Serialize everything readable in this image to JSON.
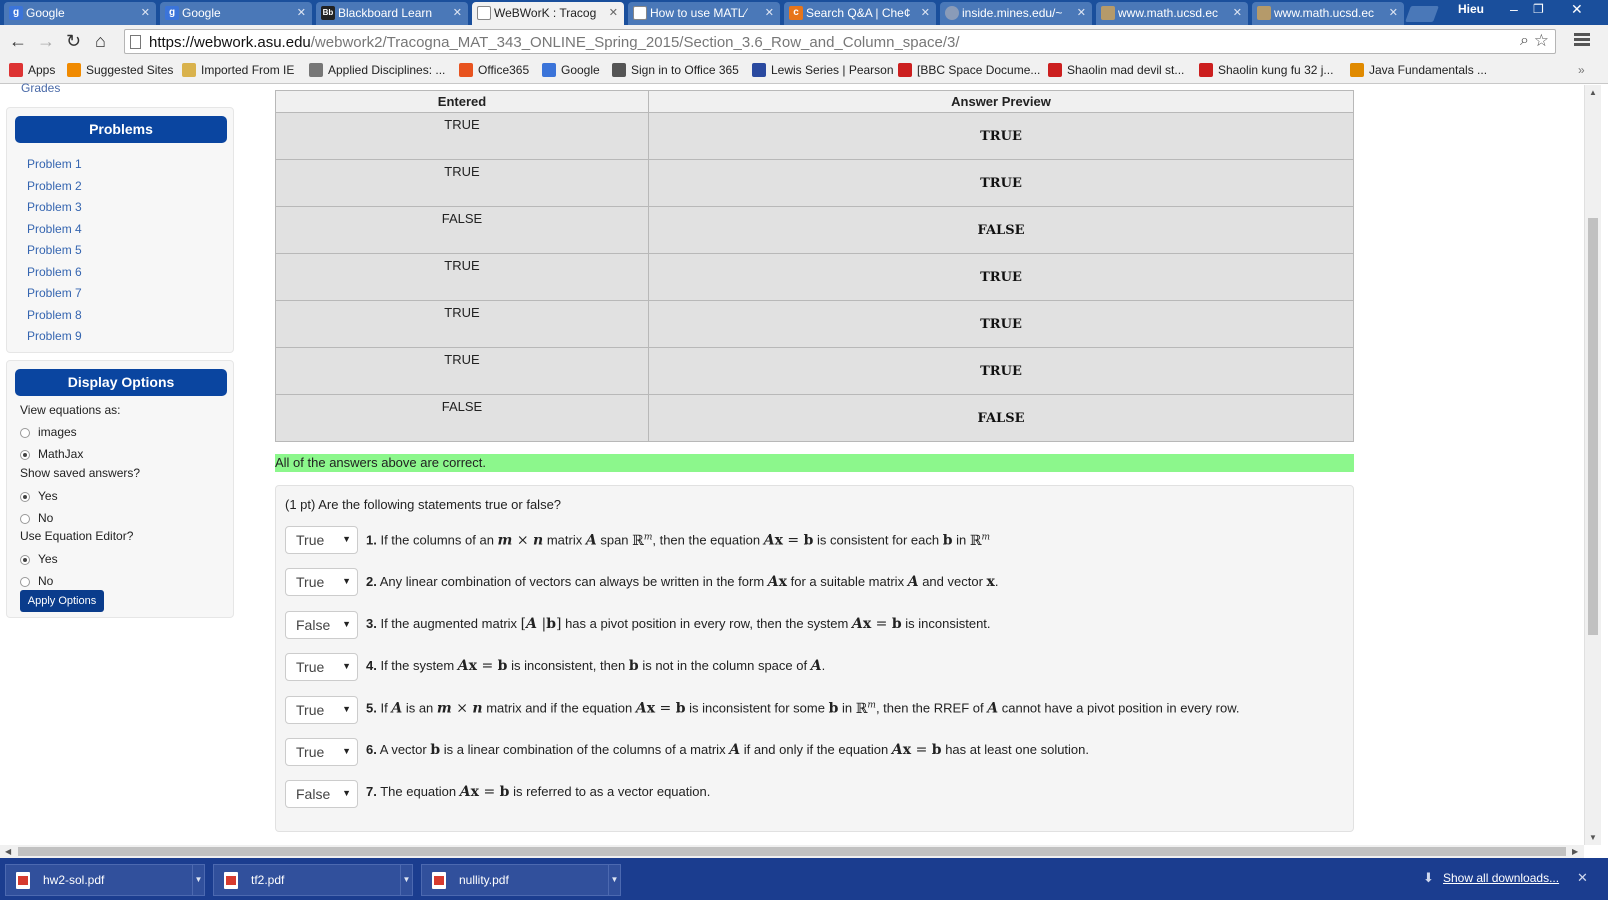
{
  "browser": {
    "tabs": [
      {
        "title": "Google",
        "favicon": "google-g-icon",
        "active": false
      },
      {
        "title": "Google",
        "favicon": "google-g-icon",
        "active": false
      },
      {
        "title": "Blackboard Learn",
        "favicon": "blackboard-icon",
        "active": false
      },
      {
        "title": "WeBWorK : Tracog",
        "favicon": "page-icon",
        "active": true
      },
      {
        "title": "How to use MATL⁄",
        "favicon": "page-icon",
        "active": false
      },
      {
        "title": "Search Q&A | Che¢",
        "favicon": "chegg-icon",
        "active": false
      },
      {
        "title": "inside.mines.edu/~",
        "favicon": "mines-icon",
        "active": false
      },
      {
        "title": "www.math.ucsd.ec",
        "favicon": "ucsd-icon",
        "active": false
      },
      {
        "title": "www.math.ucsd.ec",
        "favicon": "ucsd-icon",
        "active": false
      }
    ],
    "profile": "Hieu",
    "url_host": "https://webwork.asu.edu",
    "url_path": "/webwork2/Tracogna_MAT_343_ONLINE_Spring_2015/Section_3.6_Row_and_Column_space/3/",
    "bookmarks": [
      {
        "label": "Apps",
        "icon": "apps-grid-icon",
        "color": "#d33"
      },
      {
        "label": "Suggested Sites",
        "icon": "suggested-sites-icon",
        "color": "#f08a00"
      },
      {
        "label": "Imported From IE",
        "icon": "folder-icon",
        "color": "#d9b24c"
      },
      {
        "label": "Applied Disciplines: ...",
        "icon": "page-icon",
        "color": "#777"
      },
      {
        "label": "Office365",
        "icon": "office-icon",
        "color": "#e8531f"
      },
      {
        "label": "Google",
        "icon": "google-g-icon",
        "color": "#3b74d9"
      },
      {
        "label": "Sign in to Office 365",
        "icon": "lock-icon",
        "color": "#555"
      },
      {
        "label": "Lewis Series | Pearson",
        "icon": "pearson-icon",
        "color": "#2a4aa0"
      },
      {
        "label": "[BBC Space Docume...",
        "icon": "youtube-icon",
        "color": "#cc1f1f"
      },
      {
        "label": "Shaolin mad devil st...",
        "icon": "youtube-icon",
        "color": "#cc1f1f"
      },
      {
        "label": "Shaolin kung fu 32 j...",
        "icon": "youtube-icon",
        "color": "#cc1f1f"
      },
      {
        "label": "Java Fundamentals ...",
        "icon": "java-icon",
        "color": "#e08a00"
      }
    ],
    "bookmarks_more": "»"
  },
  "sidebar": {
    "grades_link": "Grades",
    "problems_title": "Problems",
    "problems": [
      "Problem 1",
      "Problem 2",
      "Problem 3",
      "Problem 4",
      "Problem 5",
      "Problem 6",
      "Problem 7",
      "Problem 8",
      "Problem 9"
    ],
    "display_title": "Display Options",
    "view_equations_label": "View equations as:",
    "view_equations_options": [
      {
        "label": "images",
        "checked": false
      },
      {
        "label": "MathJax",
        "checked": true
      }
    ],
    "saved_answers_label": "Show saved answers?",
    "saved_answers_options": [
      {
        "label": "Yes",
        "checked": true
      },
      {
        "label": "No",
        "checked": false
      }
    ],
    "editor_label": "Use Equation Editor?",
    "editor_options": [
      {
        "label": "Yes",
        "checked": true
      },
      {
        "label": "No",
        "checked": false
      }
    ],
    "apply_label": "Apply Options"
  },
  "results": {
    "headers": [
      "Entered",
      "Answer Preview"
    ],
    "rows": [
      {
        "entered": "TRUE",
        "preview": "TRUE"
      },
      {
        "entered": "TRUE",
        "preview": "TRUE"
      },
      {
        "entered": "FALSE",
        "preview": "FALSE"
      },
      {
        "entered": "TRUE",
        "preview": "TRUE"
      },
      {
        "entered": "TRUE",
        "preview": "TRUE"
      },
      {
        "entered": "TRUE",
        "preview": "TRUE"
      },
      {
        "entered": "FALSE",
        "preview": "FALSE"
      }
    ],
    "message": "All of the answers above are correct.",
    "message_color": "#8cf78c"
  },
  "problem": {
    "intro": "(1 pt) Are the following statements true or false?",
    "answers": [
      "True",
      "True",
      "False",
      "True",
      "True",
      "True",
      "False"
    ],
    "numbers": [
      "1.",
      "2.",
      "3.",
      "4.",
      "5.",
      "6.",
      "7."
    ],
    "s1": {
      "a": "If the columns of an",
      "b": "matrix",
      "c": "span",
      "d": ", then the equation",
      "e": "is consistent for each",
      "f": "in"
    },
    "s2": {
      "a": "Any linear combination of vectors can always be written in the form",
      "b": "for a suitable matrix",
      "c": "and vector"
    },
    "s3": {
      "a": "If the augmented matrix",
      "b": "has a pivot position in every row, then the system",
      "c": "is inconsistent."
    },
    "s4": {
      "a": "If the system",
      "b": "is inconsistent, then",
      "c": "is not in the column space of"
    },
    "s5": {
      "a": "If",
      "b": "is an",
      "c": "matrix and if the equation",
      "d": "is inconsistent for some",
      "e": "in",
      "f": ", then the RREF of",
      "g": "cannot have a pivot position in every row."
    },
    "s6": {
      "a": "A vector",
      "b": "is a linear combination of the columns of a matrix",
      "c": "if and only if the equation",
      "d": "has at least one solution."
    },
    "s7": {
      "a": "The equation",
      "b": "is referred to as a vector equation."
    }
  },
  "downloads": {
    "items": [
      "hw2-sol.pdf",
      "tf2.pdf",
      "nullity.pdf"
    ],
    "show_all": "Show all downloads..."
  }
}
